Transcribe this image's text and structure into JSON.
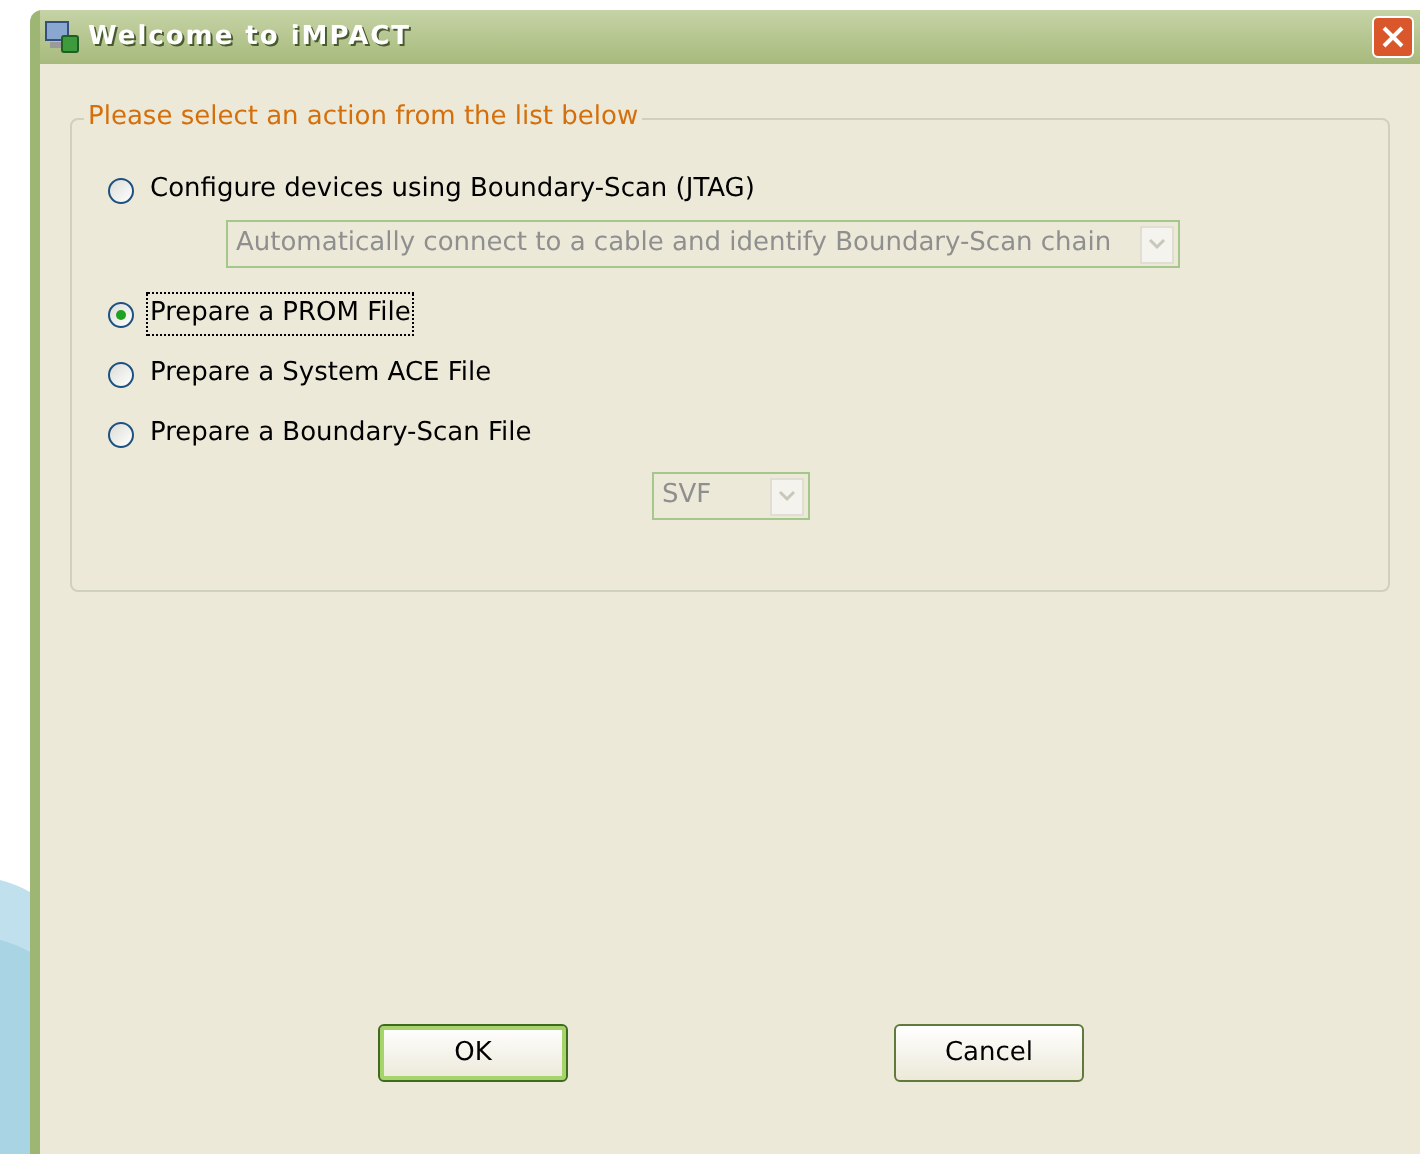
{
  "window": {
    "title": "Welcome to iMPACT"
  },
  "group": {
    "legend": "Please select an action from the list below"
  },
  "options": [
    {
      "label": "Configure devices using Boundary-Scan (JTAG)",
      "selected": false,
      "dropdown": {
        "value": "Automatically connect to a cable and identify Boundary-Scan chain",
        "disabled": true
      }
    },
    {
      "label": "Prepare a PROM File",
      "selected": true
    },
    {
      "label": "Prepare a System ACE File",
      "selected": false
    },
    {
      "label": "Prepare a Boundary-Scan File",
      "selected": false,
      "dropdown": {
        "value": "SVF",
        "disabled": true
      }
    }
  ],
  "buttons": [
    {
      "label": "OK",
      "default": true
    },
    {
      "label": "Cancel",
      "default": false
    }
  ]
}
